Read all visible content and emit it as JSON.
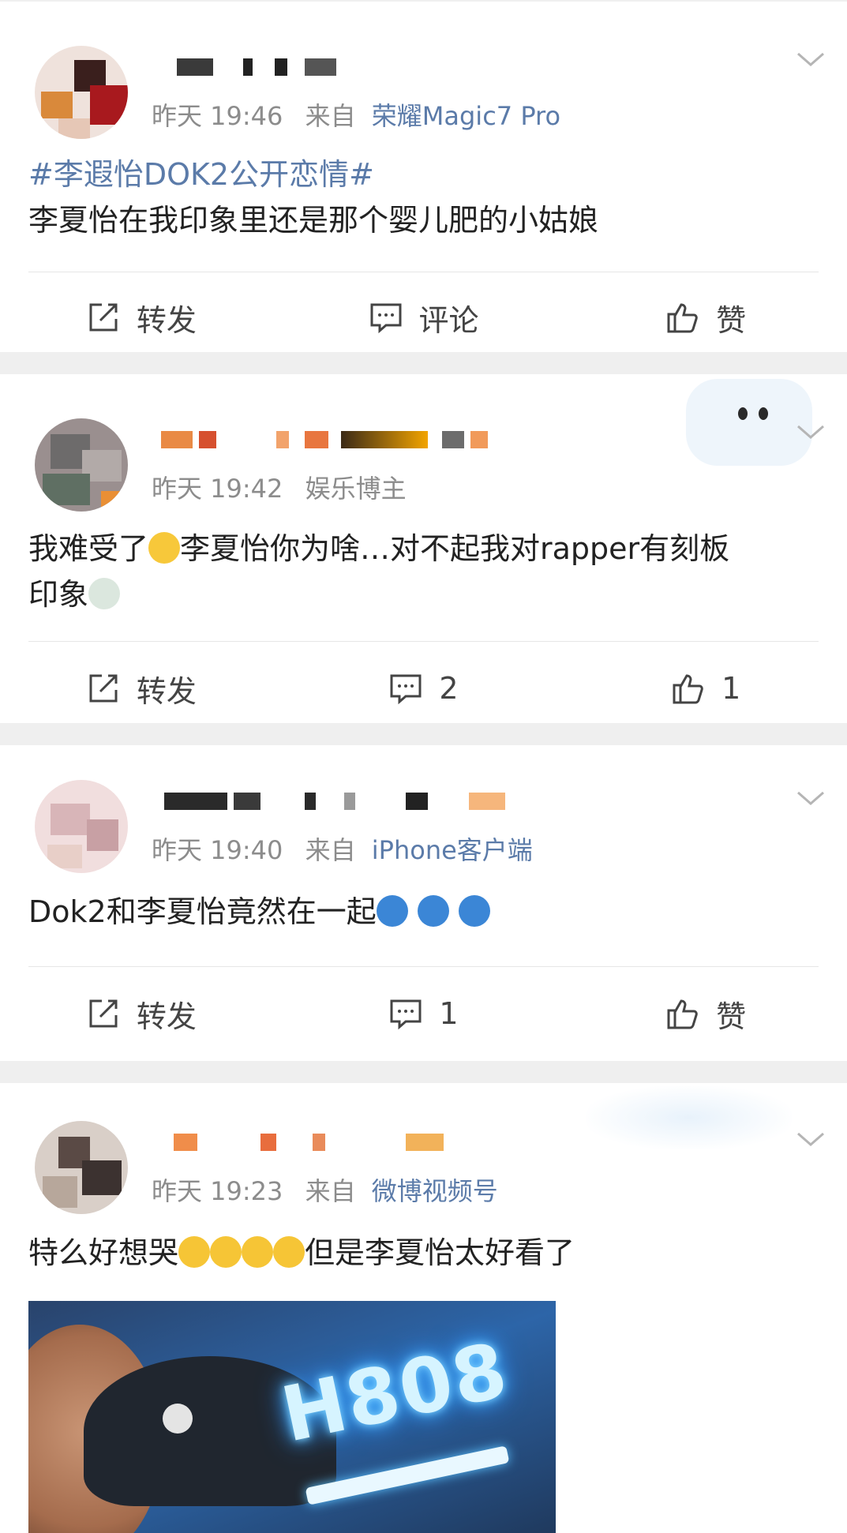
{
  "posts": [
    {
      "time": "昨天 19:46",
      "source_prefix": "来自",
      "source": "荣耀Magic7 Pro",
      "topic": "#李遐怡DOK2公开恋情#",
      "text": "李夏怡在我印象里还是那个婴儿肥的小姑娘",
      "actions": {
        "repost": "转发",
        "comment": "评论",
        "like": "赞"
      }
    },
    {
      "time": "昨天 19:42",
      "badge": "娱乐博主",
      "text_line1_a": "我难受了",
      "text_line1_b": "李夏怡你为啥…对不起我对rapper有刻板",
      "text_line2": "印象",
      "actions": {
        "repost": "转发",
        "comment": "2",
        "like": "1"
      }
    },
    {
      "time": "昨天 19:40",
      "source_prefix": "来自",
      "source": "iPhone客户端",
      "text": "Dok2和李夏怡竟然在一起",
      "actions": {
        "repost": "转发",
        "comment": "1",
        "like": "赞"
      }
    },
    {
      "time": "昨天 19:23",
      "source_prefix": "来自",
      "source": "微博视频号",
      "text_a": "特么好想哭",
      "text_b": "但是李夏怡太好看了",
      "image_sign": "H808"
    }
  ],
  "emoji": [
    "persevering-face",
    "drooling-face",
    "doraemon-face",
    "loudly-crying-face"
  ],
  "icons": [
    "repost-icon",
    "comment-icon",
    "like-icon",
    "chevron-down-icon"
  ]
}
